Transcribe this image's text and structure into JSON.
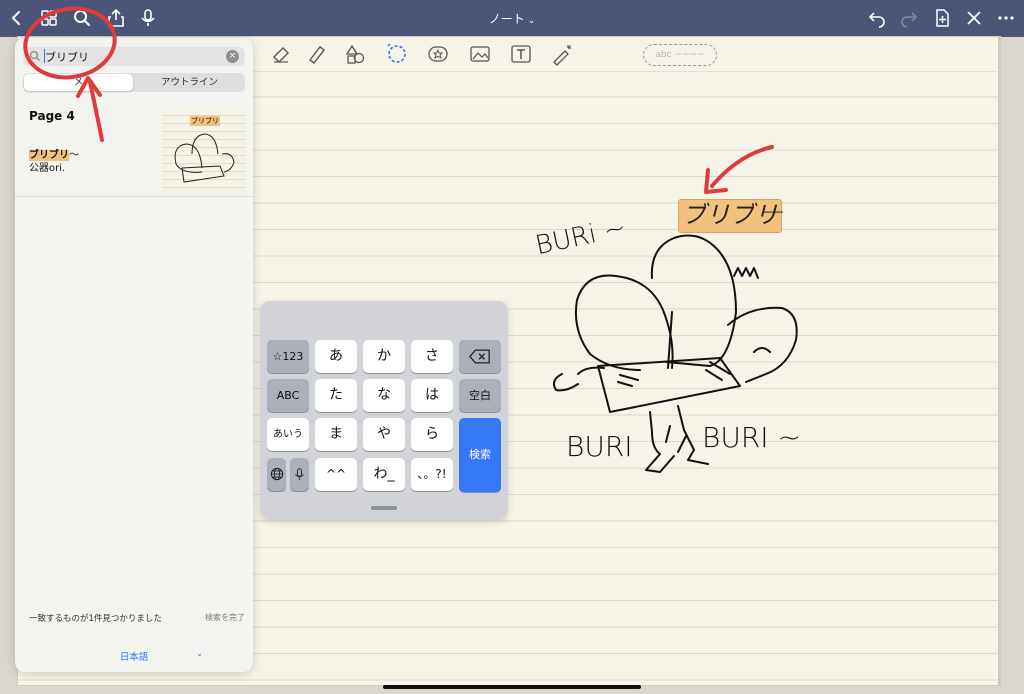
{
  "toolbar": {
    "title": "ノート",
    "title_chevron": "⌄",
    "left_icons": [
      "chevron-left-icon",
      "grid-icon",
      "search-icon",
      "share-icon",
      "mic-icon"
    ],
    "right_icons": [
      "undo-icon",
      "redo-icon",
      "add-page-icon",
      "close-icon",
      "more-icon"
    ]
  },
  "tools": [
    "eraser-icon",
    "highlighter-icon",
    "shapes-icon",
    "lasso-icon",
    "sticker-icon",
    "image-icon",
    "text-icon",
    "laser-icon"
  ],
  "tool_pill_text": "abc ~~~~",
  "search_panel": {
    "query": "ブリブリ",
    "segments": [
      "メ",
      "アウトライン"
    ],
    "results": [
      {
        "title": "Page 4",
        "snippet_highlight": "ブリブリ",
        "snippet_rest": "～",
        "snippet_line2": "公器ori.",
        "thumb_text": "ブリブリ"
      }
    ],
    "found_text": "一致するものが1件見つかりました",
    "done_label": "検索を完了",
    "language": "日本語",
    "language_chevron": "⌄"
  },
  "canvas": {
    "highlighted_word": "ブリブリ",
    "drawn_labels": [
      "BURi ~",
      "BURI",
      "BURI ~"
    ],
    "dash": "—"
  },
  "keyboard": {
    "row1": [
      "☆123",
      "あ",
      "か",
      "さ"
    ],
    "row2": [
      "ABC",
      "た",
      "な",
      "は",
      "空白"
    ],
    "row3": [
      "あいう",
      "ま",
      "や",
      "ら"
    ],
    "row4": [
      "^^",
      "わ_",
      "、。?!"
    ],
    "search_key": "検索"
  },
  "colors": {
    "topbar": "#4a5578",
    "highlight": "#f2c27c",
    "annotation_red": "#e03a3a",
    "accent_blue": "#3478f6"
  }
}
